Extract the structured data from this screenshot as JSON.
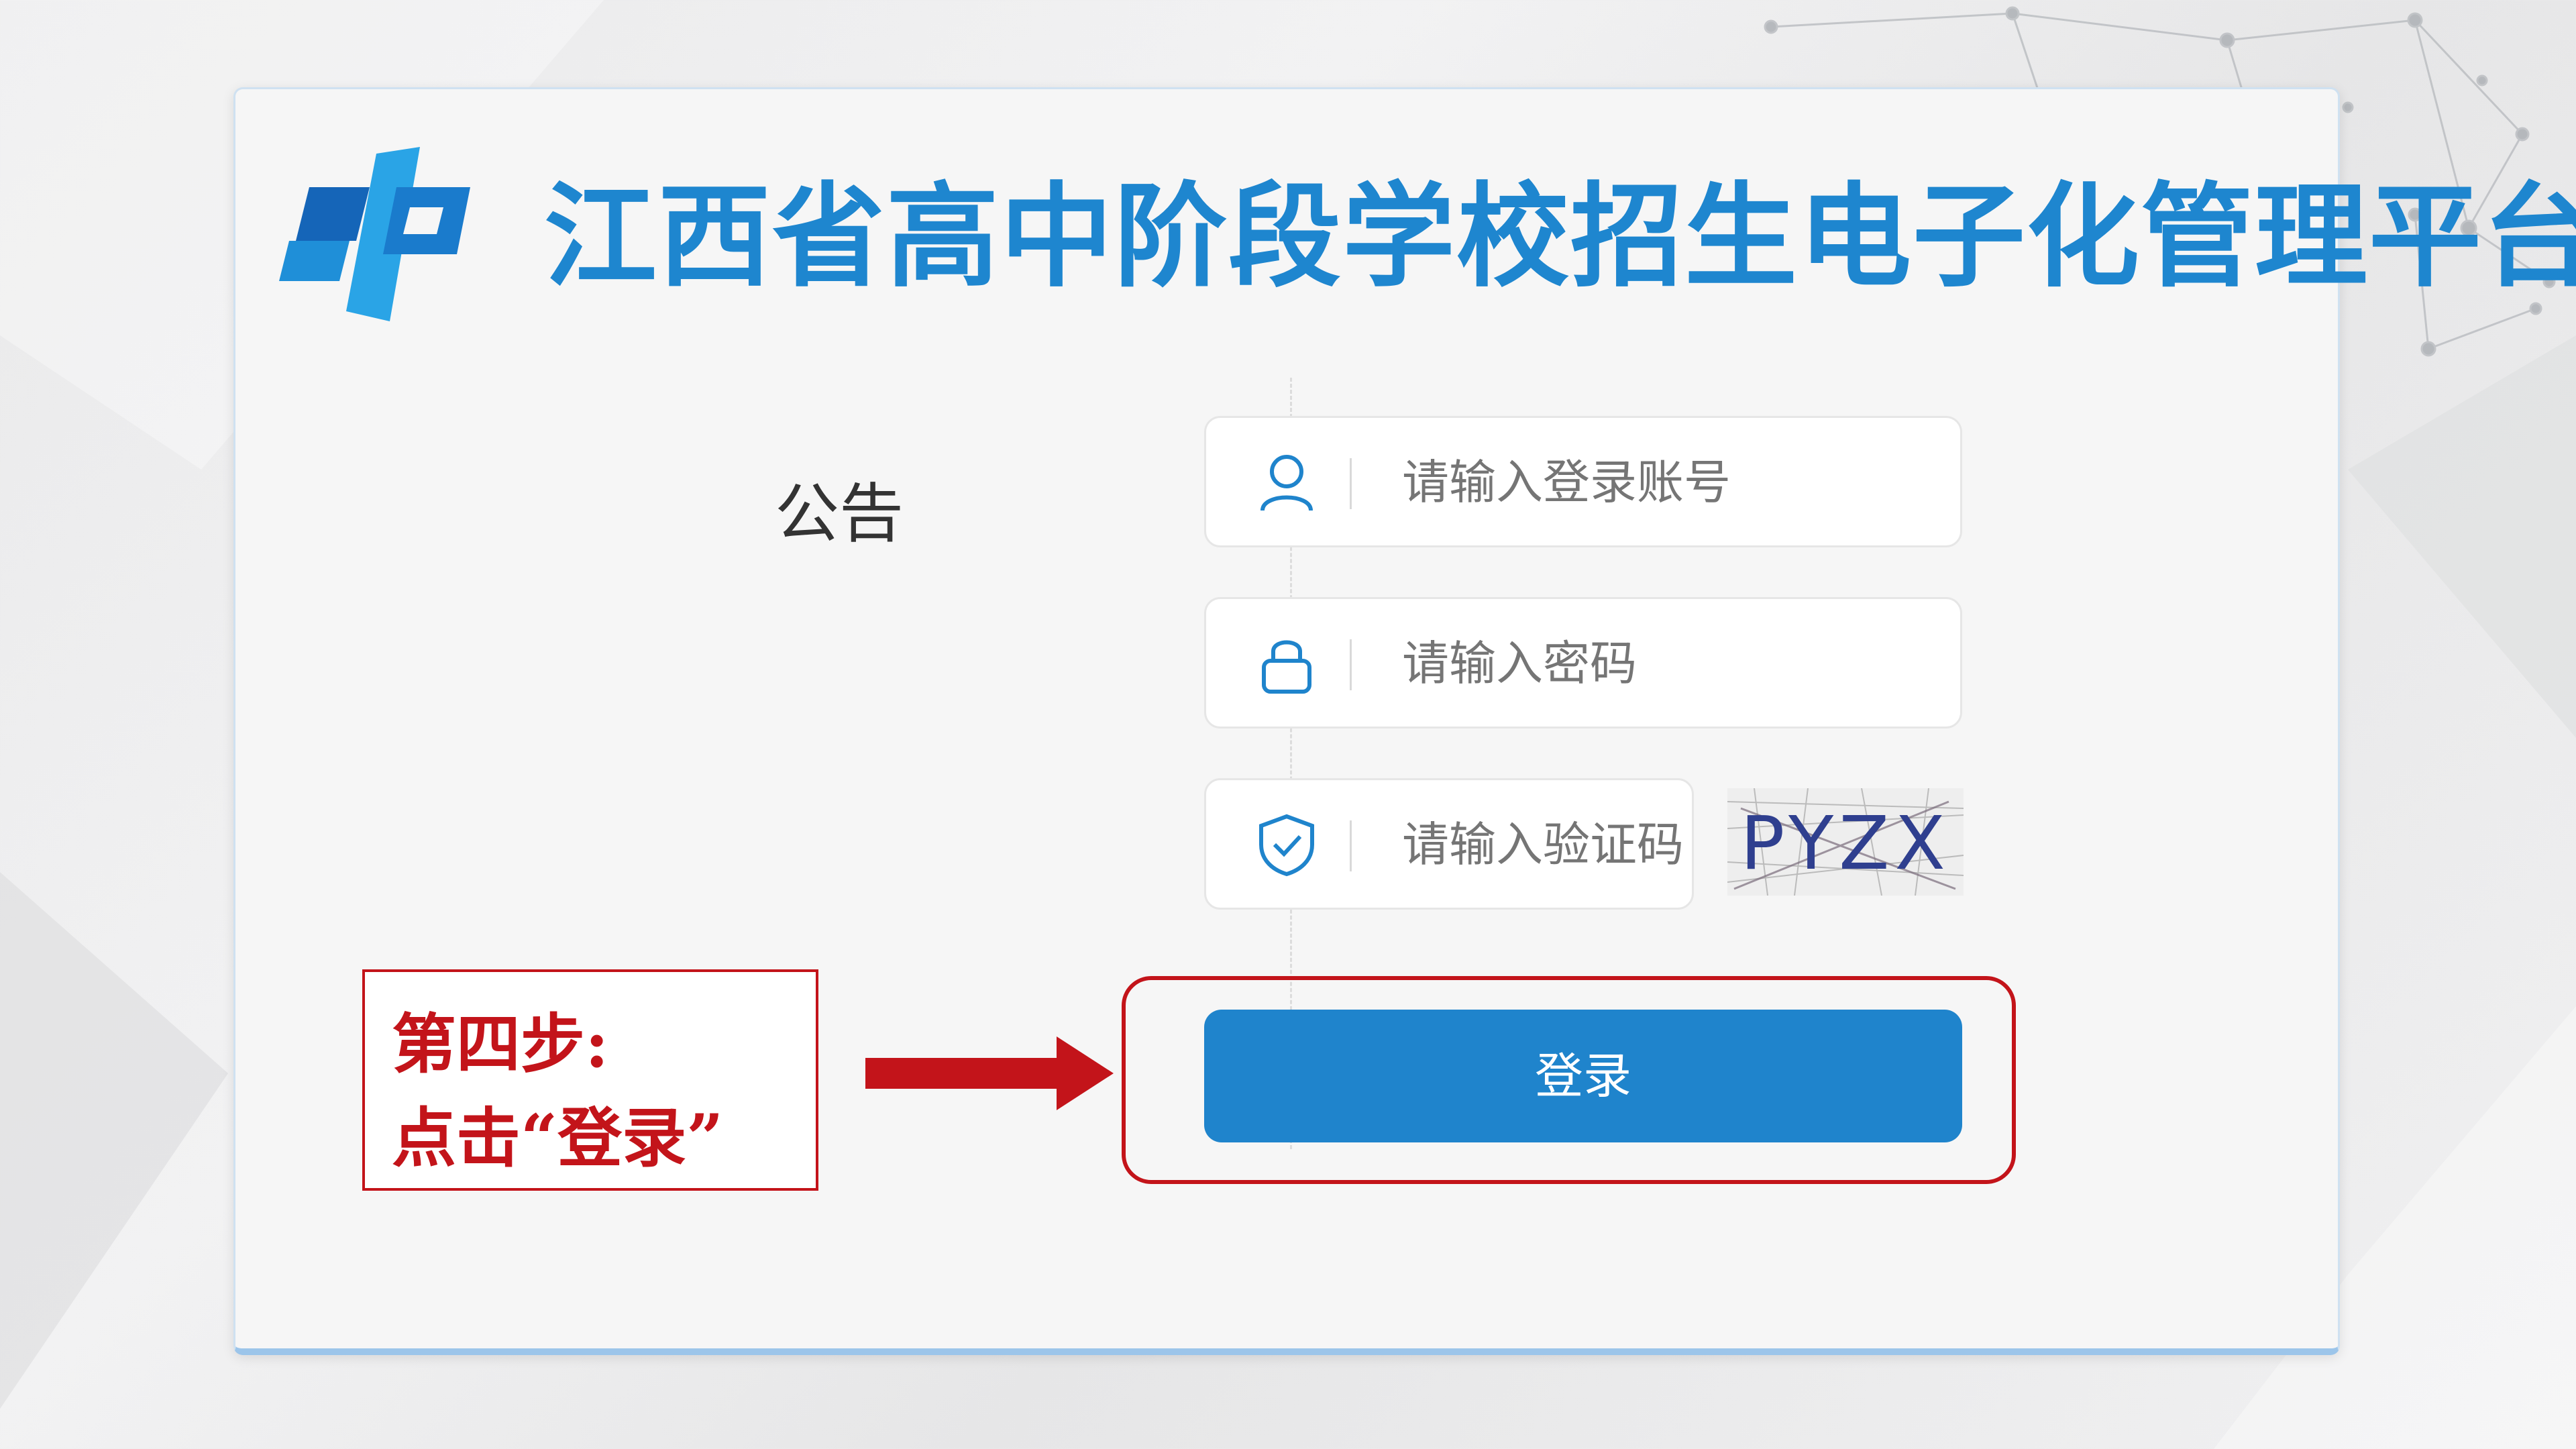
{
  "header": {
    "title": "江西省高中阶段学校招生电子化管理平台"
  },
  "notice": {
    "heading": "公告"
  },
  "login": {
    "heading": "登录",
    "account_placeholder": "请输入登录账号",
    "password_placeholder": "请输入密码",
    "captcha_placeholder": "请输入验证码",
    "captcha_text": "PYZX",
    "button_label": "登录"
  },
  "annotation": {
    "line1": "第四步:",
    "line2": "点击“登录”"
  },
  "colors": {
    "brand_blue": "#1e86cf",
    "button_blue": "#1f84cc",
    "annotation_red": "#c3141a"
  },
  "icons": {
    "account": "user-icon",
    "password": "lock-icon",
    "captcha": "shield-check-icon"
  }
}
